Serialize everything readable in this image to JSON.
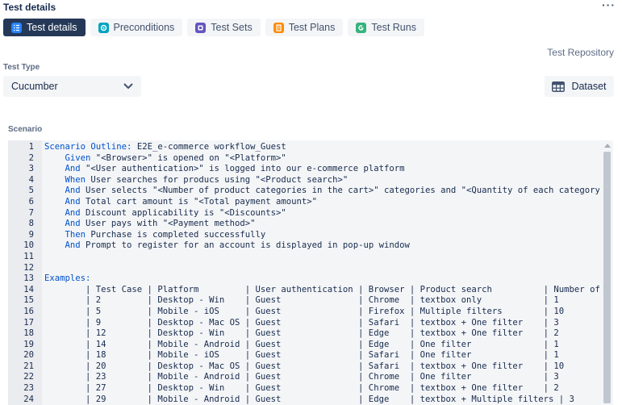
{
  "header": {
    "title": "Test details",
    "more_label": "···"
  },
  "tabs": [
    {
      "label": "Test details",
      "icon": "list-icon",
      "color": "#2684ff",
      "active": true
    },
    {
      "label": "Preconditions",
      "icon": "precondition-icon",
      "color": "#00a3bf",
      "active": false
    },
    {
      "label": "Test Sets",
      "icon": "test-sets-icon",
      "color": "#6554c0",
      "active": false
    },
    {
      "label": "Test Plans",
      "icon": "test-plans-icon",
      "color": "#ff8b00",
      "active": false
    },
    {
      "label": "Test Runs",
      "icon": "test-runs-icon",
      "color": "#36b37e",
      "active": false
    }
  ],
  "repository_link": "Test Repository",
  "test_type": {
    "label": "Test Type",
    "value": "Cucumber"
  },
  "dataset_button": {
    "label": "Dataset",
    "icon": "table-icon"
  },
  "scenario": {
    "label": "Scenario",
    "lines": [
      {
        "num": "1",
        "kw": "Scenario Outline:",
        "rest": " E2E_e-commerce workflow_Guest",
        "indent": ""
      },
      {
        "num": "2",
        "kw": "Given",
        "rest": " \"<Browser>\" is opened on \"<Platform>\"",
        "indent": "    "
      },
      {
        "num": "3",
        "kw": "And",
        "rest": " \"<User authentication>\" is logged into our e-commerce platform",
        "indent": "    "
      },
      {
        "num": "4",
        "kw": "When",
        "rest": " User searches for producs using \"<Product search>\"",
        "indent": "    "
      },
      {
        "num": "5",
        "kw": "And",
        "rest": " User selects \"<Number of product categories in the cart>\" categories and \"<Quantity of each category>\"",
        "indent": "    "
      },
      {
        "num": "6",
        "kw": "And",
        "rest": " Total cart amount is \"<Total payment amount>\"",
        "indent": "    "
      },
      {
        "num": "7",
        "kw": "And",
        "rest": " Discount applicability is \"<Discounts>\"",
        "indent": "    "
      },
      {
        "num": "8",
        "kw": "And",
        "rest": " User pays with \"<Payment method>\"",
        "indent": "    "
      },
      {
        "num": "9",
        "kw": "Then",
        "rest": " Purchase is completed successfully",
        "indent": "    "
      },
      {
        "num": "10",
        "kw": "And",
        "rest": " Prompt to register for an account is displayed in pop-up window",
        "indent": "    "
      },
      {
        "num": "11",
        "kw": "",
        "rest": "",
        "indent": ""
      },
      {
        "num": "12",
        "kw": "",
        "rest": "",
        "indent": ""
      },
      {
        "num": "13",
        "kw": "Examples:",
        "rest": "",
        "indent": ""
      },
      {
        "num": "14",
        "kw": "",
        "rest": "        | Test Case | Platform         | User authentication | Browser | Product search          | Number of",
        "indent": ""
      },
      {
        "num": "15",
        "kw": "",
        "rest": "        | 2         | Desktop - Win    | Guest               | Chrome  | textbox only            | 1",
        "indent": ""
      },
      {
        "num": "16",
        "kw": "",
        "rest": "        | 5         | Mobile - iOS     | Guest               | Firefox | Multiple filters        | 10",
        "indent": ""
      },
      {
        "num": "17",
        "kw": "",
        "rest": "        | 9         | Desktop - Mac OS | Guest               | Safari  | textbox + One filter    | 3",
        "indent": ""
      },
      {
        "num": "18",
        "kw": "",
        "rest": "        | 12        | Desktop - Win    | Guest               | Edge    | textbox + One filter    | 2",
        "indent": ""
      },
      {
        "num": "19",
        "kw": "",
        "rest": "        | 14        | Mobile - Android | Guest               | Edge    | One filter              | 1",
        "indent": ""
      },
      {
        "num": "20",
        "kw": "",
        "rest": "        | 18        | Mobile - iOS     | Guest               | Safari  | One filter              | 1",
        "indent": ""
      },
      {
        "num": "21",
        "kw": "",
        "rest": "        | 20        | Desktop - Mac OS | Guest               | Safari  | textbox + One filter    | 10",
        "indent": ""
      },
      {
        "num": "22",
        "kw": "",
        "rest": "        | 23        | Mobile - Android | Guest               | Chrome  | One filter              | 3",
        "indent": ""
      },
      {
        "num": "23",
        "kw": "",
        "rest": "        | 27        | Desktop - Win    | Guest               | Chrome  | textbox + One filter    | 2",
        "indent": ""
      },
      {
        "num": "24",
        "kw": "",
        "rest": "        | 29        | Mobile - Android | Guest               | Edge    | textbox + Multiple filters | 3",
        "indent": ""
      }
    ]
  },
  "colors": {
    "active_tab_bg": "#253858",
    "keyword": "#0052cc",
    "editor_bg": "#f4f5f7"
  }
}
